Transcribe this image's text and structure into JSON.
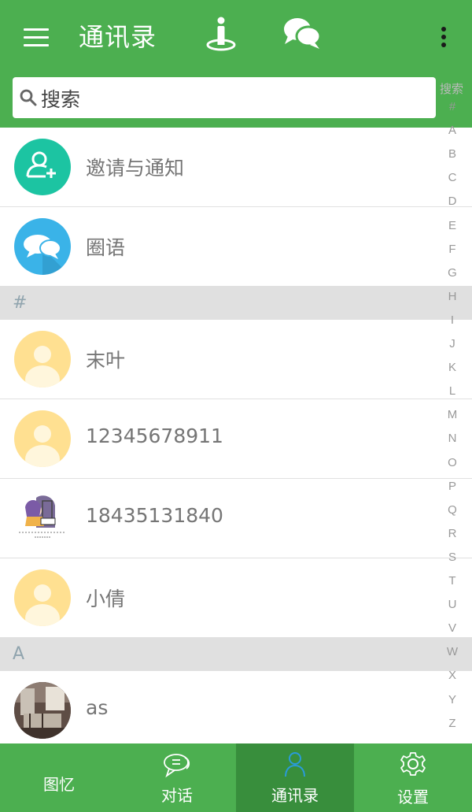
{
  "appbar": {
    "title": "通讯录",
    "icons": [
      "menu-icon",
      "location-person-icon",
      "chat-bubbles-icon",
      "more-vert-icon"
    ]
  },
  "search": {
    "placeholder": "搜索",
    "index_search_label": "搜索"
  },
  "special_items": [
    {
      "name": "邀请与通知",
      "icon": "add-user-icon",
      "color": "#1cc4a2"
    },
    {
      "name": "圈语",
      "icon": "chat-bubbles-icon",
      "color": "#3ab3e8"
    }
  ],
  "sections": [
    {
      "letter": "#",
      "contacts": [
        {
          "name": "末叶",
          "avatar": "default-avatar"
        },
        {
          "name": "12345678911",
          "avatar": "default-avatar"
        },
        {
          "name": "18435131840",
          "avatar": "photo-girl-avatar"
        },
        {
          "name": "小倩",
          "avatar": "default-avatar"
        }
      ]
    },
    {
      "letter": "A",
      "contacts": [
        {
          "name": "as",
          "avatar": "photo-avatar"
        }
      ]
    }
  ],
  "index_letters": [
    "#",
    "A",
    "B",
    "C",
    "D",
    "E",
    "F",
    "G",
    "H",
    "I",
    "J",
    "K",
    "L",
    "M",
    "N",
    "O",
    "P",
    "Q",
    "R",
    "S",
    "T",
    "U",
    "V",
    "W",
    "X",
    "Y",
    "Z"
  ],
  "bottom_nav": {
    "tabs": [
      {
        "label": "图忆",
        "icon": "",
        "active": false
      },
      {
        "label": "对话",
        "icon": "chat-icon",
        "active": false
      },
      {
        "label": "通讯录",
        "icon": "contacts-icon",
        "active": true
      },
      {
        "label": "设置",
        "icon": "settings-icon",
        "active": false
      }
    ]
  },
  "colors": {
    "primary": "#4caf50",
    "primary_dark": "#388e3c",
    "section_bg": "#e0e0e0",
    "default_avatar": "#ffe091"
  }
}
